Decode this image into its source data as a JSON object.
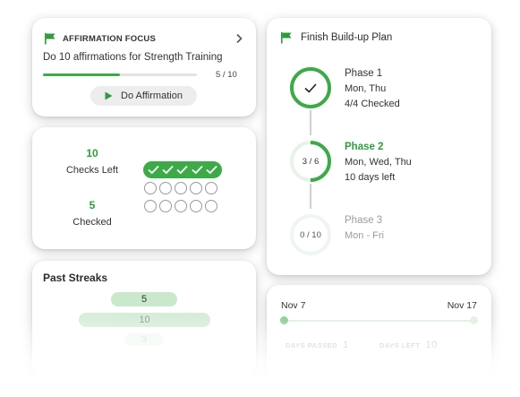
{
  "affirmation": {
    "heading": "AFFIRMATION FOCUS",
    "task": "Do 10 affirmations for Strength Training",
    "progress_label": "5 / 10",
    "progress_fraction": 0.5,
    "button_label": "Do Affirmation",
    "icons": {
      "flag": "flag-icon",
      "chevron": "chevron-right-icon",
      "play": "play-icon"
    }
  },
  "checks": {
    "left_value": "10",
    "left_label": "Checks Left",
    "checked_value": "5",
    "checked_label": "Checked",
    "completed_count": 5,
    "remaining_count": 10
  },
  "streaks": {
    "title": "Past Streaks",
    "items": [
      "5",
      "10",
      "3"
    ]
  },
  "plan": {
    "title": "Finish Build-up Plan",
    "phases": [
      {
        "name": "Phase 1",
        "days": "Mon, Thu",
        "status": "4/4 Checked",
        "ring_label": "",
        "progress": 1.0
      },
      {
        "name": "Phase 2",
        "days": "Mon, Wed, Thu",
        "status": "10 days left",
        "ring_label": "3 / 6",
        "progress": 0.5
      },
      {
        "name": "Phase 3",
        "days": "Mon - Fri",
        "status": "",
        "ring_label": "0 / 10",
        "progress": 0.0
      }
    ]
  },
  "dates": {
    "start": "Nov 7",
    "end": "Nov 17",
    "days_passed_label": "DAYS PASSED",
    "days_passed_value": "1",
    "days_left_label": "DAYS LEFT",
    "days_left_value": "10"
  },
  "colors": {
    "accent": "#3daa48",
    "accent_dark": "#2d9c3c",
    "accent_light": "#c9e8cc",
    "muted_ring": "#e6f3e7"
  }
}
